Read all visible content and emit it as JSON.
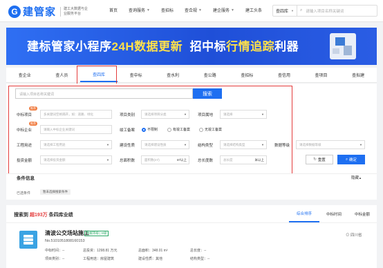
{
  "header": {
    "logo_mark": "G",
    "logo_text": "建管家",
    "logo_tagline": "建工大数据与企业服务平台",
    "nav": [
      {
        "label": "首页",
        "caret": false
      },
      {
        "label": "查询服务",
        "caret": true
      },
      {
        "label": "查招标",
        "caret": false
      },
      {
        "label": "查合规",
        "caret": true
      },
      {
        "label": "建企服务",
        "caret": true
      },
      {
        "label": "建工头条",
        "caret": false
      }
    ],
    "search_scope": "查四库",
    "search_placeholder": "请输入项目名称关键词"
  },
  "banner": {
    "part1": "建标管家小程序",
    "part2": "24H数据更新",
    "part3": "招中标",
    "part4": "行情追踪",
    "part5": "利器"
  },
  "tabs": [
    "查企业",
    "查人员",
    "查四库",
    "查中标",
    "查水利",
    "查公路",
    "查招标",
    "查信用",
    "查项目",
    "查拟建"
  ],
  "filters": {
    "keyword_placeholder": "请输入项目名称关键词",
    "search_button": "搜索",
    "hot_badge": "推荐",
    "bid_project_label": "中标项目",
    "bid_project_placeholder": "多关键词空格隔开，如：道路、绿化",
    "project_category_label": "项目类别",
    "project_category_placeholder": "请选择项目分类",
    "project_location_label": "项目属地",
    "project_location_placeholder": "请选择",
    "bid_company_label": "中标企业",
    "bid_company_placeholder": "请输入中标企业关键词",
    "construction_plan_label": "竣工备案",
    "radio_unlimited": "不限制",
    "radio_has": "有竣工备案",
    "radio_none": "无竣工备案",
    "engineering_use_label": "工程用途",
    "engineering_use_placeholder": "请选择工程用途",
    "construction_nature_label": "建设性质",
    "construction_nature_placeholder": "请选择建设性质",
    "structure_type_label": "结构类型",
    "structure_type_placeholder": "请选择结构类型",
    "data_level_label": "数据等级",
    "data_level_placeholder": "请选择数据等级",
    "investment_label": "投资金额",
    "investment_placeholder": "请选择投资金额",
    "total_area_label": "总面积数",
    "total_area_placeholder": "面积数(m²)",
    "total_area_unit": "m²以上",
    "total_length_label": "总长度数",
    "total_length_placeholder": "总长度",
    "total_length_unit": "米以上",
    "reset_button": "重置",
    "confirm_button": "确定"
  },
  "conditions": {
    "title": "条件信息",
    "hide_label": "隐藏",
    "selected_label": "已选条件",
    "selected_tag": "暂未选择搜索条件"
  },
  "results": {
    "prefix": "搜索到",
    "count": "超193万",
    "suffix": "条四库业绩",
    "sort_tabs": [
      "综合排序",
      "中标时间",
      "中标金额"
    ]
  },
  "card": {
    "title": "清波公交场站施工",
    "badge": "数据等级 | D级",
    "location": "四川省",
    "number": "No.5101051808160153",
    "bid_time": "中标时间：--",
    "investment": "总投资：1298.81 万元",
    "area": "总面积：348.01 m²",
    "length": "总长度：--",
    "category": "项目类别：--",
    "use": "工程用途：房屋建筑",
    "nature": "建设性质：其他",
    "structure": "结构类型：--"
  }
}
